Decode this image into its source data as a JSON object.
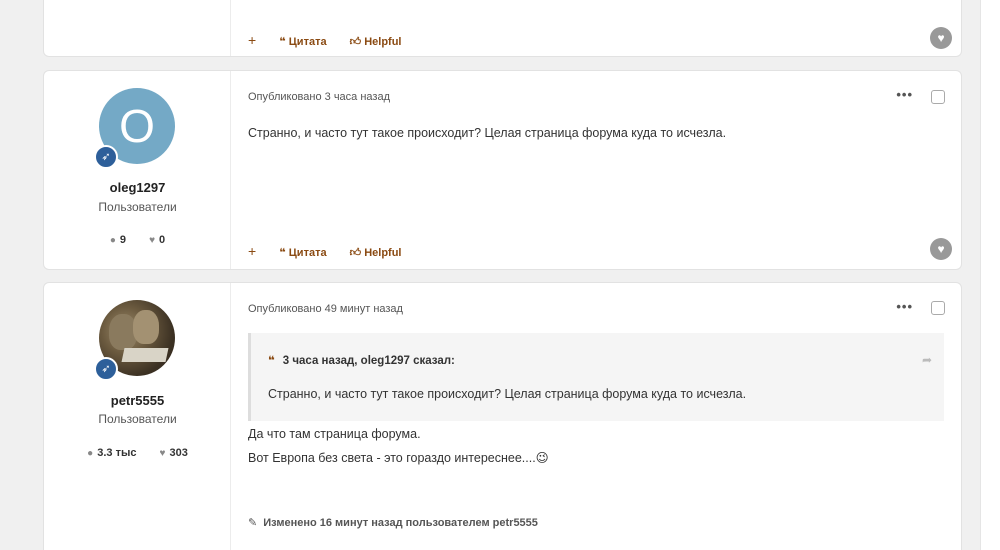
{
  "actions": {
    "plus": "+",
    "quote_label": "Цитата",
    "helpful_label": "Helpful",
    "quote_icon": "quote-icon",
    "helpful_icon": "thumbs-up-icon"
  },
  "posts": [
    {
      "id": "top-partial"
    },
    {
      "id": "p1",
      "avatar_letter": "O",
      "avatar_color": "#74a9c6",
      "username": "oleg1297",
      "group": "Пользователи",
      "stat_posts": "9",
      "stat_likes": "0",
      "posted": "Опубликовано 3 часа назад",
      "body": "Странно, и часто тут такое происходит? Целая страница форума куда то исчезла."
    },
    {
      "id": "p2",
      "username": "petr5555",
      "group": "Пользователи",
      "stat_posts": "3.3 тыс",
      "stat_likes": "303",
      "posted": "Опубликовано 49 минут назад",
      "quote_header": "3 часа назад, oleg1297 сказал:",
      "quote_text": "Странно, и часто тут такое происходит? Целая страница форума куда то исчезла.",
      "body_line1": "Да что там страница форума.",
      "body_line2": "Вот Европа без света - это гораздо интереснее....😉",
      "edited": "Изменено 16 минут назад пользователем petr5555"
    }
  ],
  "colors": {
    "accent": "#8a4a12",
    "badge": "#2d5f9a",
    "heart": "#999999"
  }
}
